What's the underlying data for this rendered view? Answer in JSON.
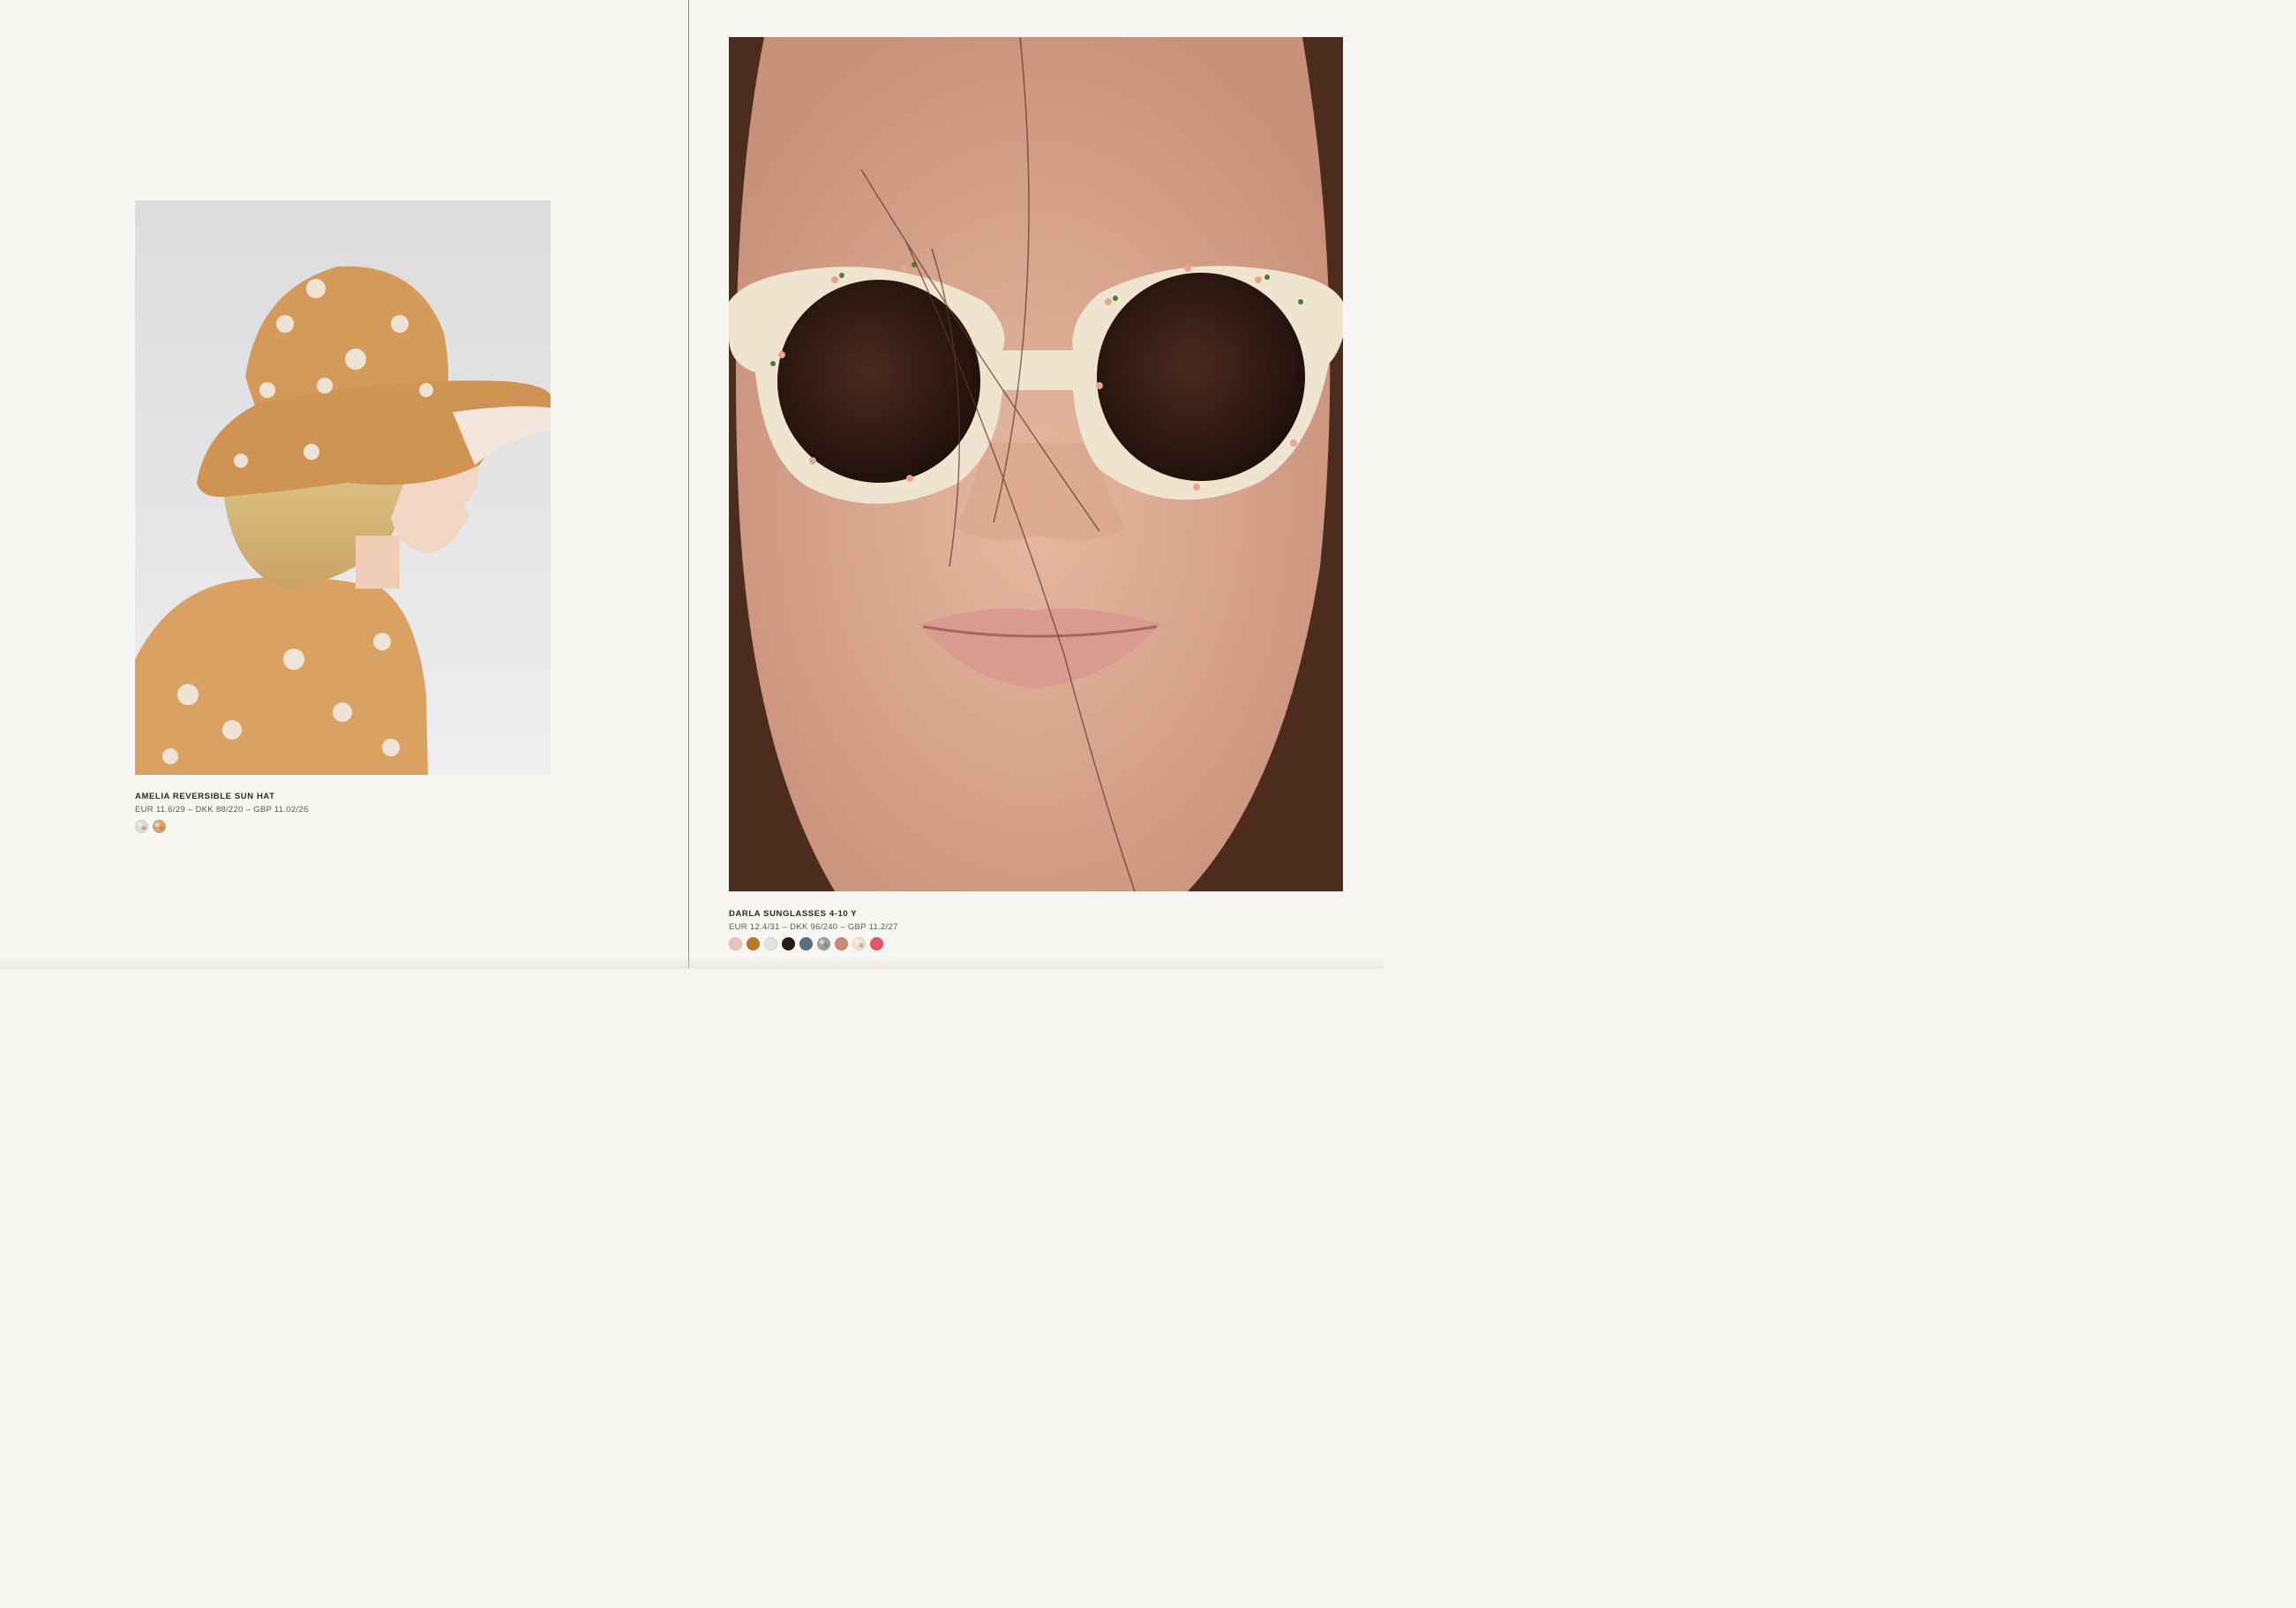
{
  "left_page": {
    "product": {
      "name": "AMELIA REVERSIBLE SUN HAT",
      "price": "EUR 11.6/29 – DKK 88/220 – GBP 11.02/26",
      "swatches": [
        {
          "color": "#dedad2",
          "pattern": "light-print"
        },
        {
          "color": "#d9a56b",
          "pattern": "cherry-print"
        }
      ]
    }
  },
  "right_page": {
    "product": {
      "name": "DARLA SUNGLASSES 4-10 Y",
      "price": "EUR 12.4/31 – DKK 96/240 – GBP 11.2/27",
      "swatches": [
        {
          "color": "#e8c3bd"
        },
        {
          "color": "#b57a2c"
        },
        {
          "color": "#e3e2e0"
        },
        {
          "color": "#2a1a14"
        },
        {
          "color": "#5d6e7c"
        },
        {
          "color": "#9aa0a2",
          "pattern": "tortoise"
        },
        {
          "color": "#c98978"
        },
        {
          "color": "#ede0d2",
          "pattern": "print"
        },
        {
          "color": "#e2566a"
        }
      ]
    }
  }
}
